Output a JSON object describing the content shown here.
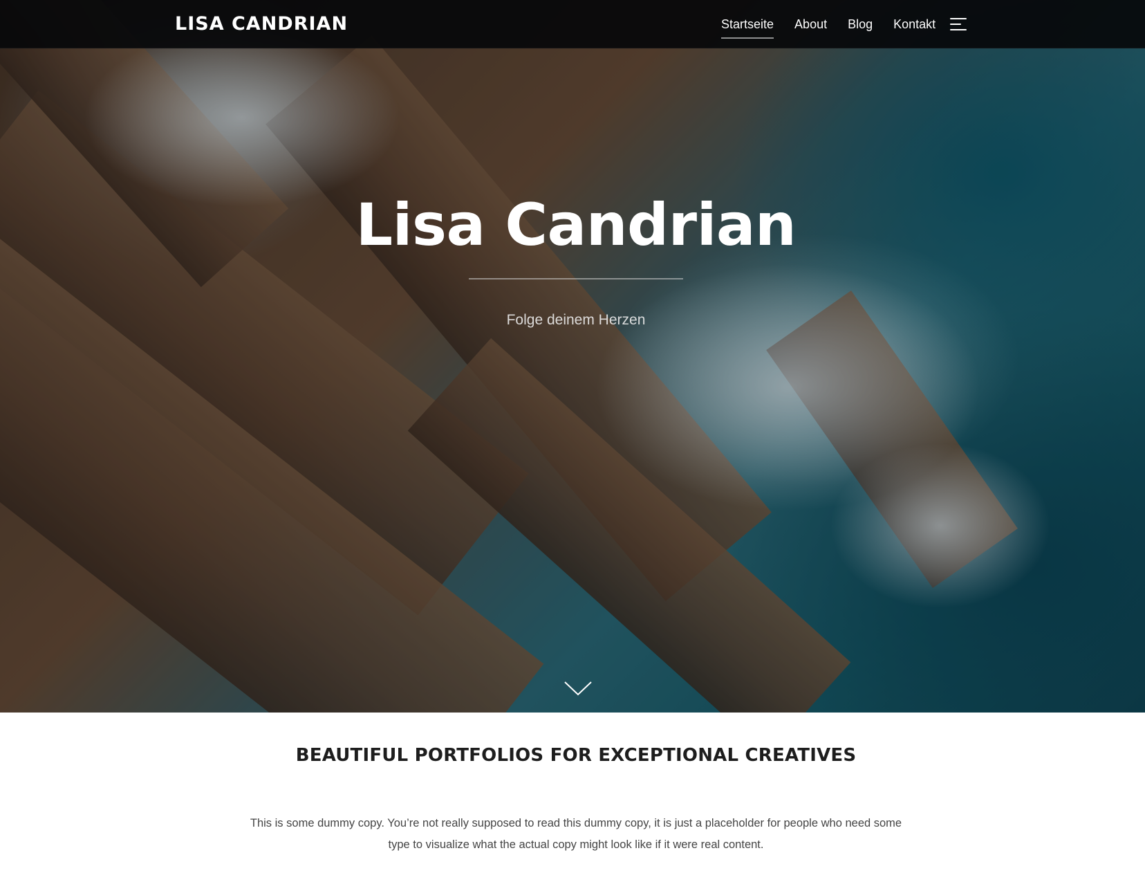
{
  "header": {
    "logo": "LISA CANDRIAN",
    "nav": [
      {
        "label": "Startseite",
        "active": true
      },
      {
        "label": "About",
        "active": false
      },
      {
        "label": "Blog",
        "active": false
      },
      {
        "label": "Kontakt",
        "active": false
      }
    ],
    "menu_icon": "hamburger-menu-icon"
  },
  "hero": {
    "title": "Lisa Candrian",
    "subtitle": "Folge deinem Herzen",
    "scroll_icon": "chevron-down-icon"
  },
  "content": {
    "heading": "BEAUTIFUL PORTFOLIOS FOR EXCEPTIONAL CREATIVES",
    "body": "This is some dummy copy. You’re not really supposed to read this dummy copy, it is just a placeholder for people who need some type to visualize what the actual copy might look like if it were real content."
  },
  "colors": {
    "header_bg": "#06080a",
    "text_dark": "#1d1d1d",
    "text_body": "#444444"
  }
}
